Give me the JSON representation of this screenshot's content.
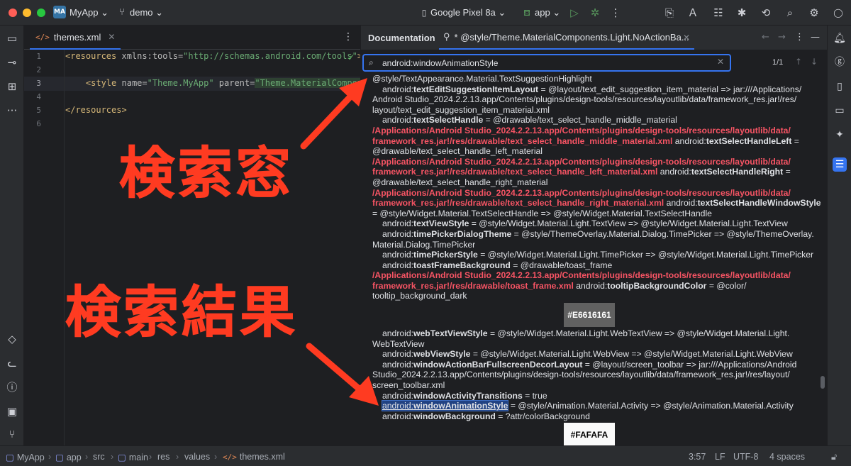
{
  "titlebar": {
    "project_badge": "MA",
    "project_name": "MyApp",
    "branch": "demo",
    "device": "Google Pixel 8a",
    "run_config": "app",
    "icons": [
      "folder-icon",
      "branch-icon",
      "device-icon",
      "android-icon",
      "run-icon",
      "debug-icon",
      "gradle-icon",
      "translate-icon",
      "layout-icon",
      "bug-icon",
      "sync-icon",
      "search-icon",
      "gear-icon"
    ]
  },
  "editor": {
    "tab_label": "themes.xml",
    "tab_icon": "</>",
    "line_numbers": [
      "1",
      "2",
      "3",
      "4",
      "5",
      "6"
    ],
    "lines": [
      {
        "tag_open": "<resources",
        "attr": " xmlns:tools=",
        "val": "\"http://schemas.android.com/tools\"",
        "tag_close": ">"
      },
      {
        "text": ""
      },
      {
        "indent": "    ",
        "tag_open": "<style",
        "attr1": " name=",
        "val1": "\"Theme.MyApp\"",
        "attr2": " parent=",
        "val2": "\"Theme.MaterialComponents"
      },
      {
        "text": ""
      },
      {
        "tag_open": "</resources>"
      },
      {
        "text": ""
      }
    ]
  },
  "documentation": {
    "panel_title": "Documentation",
    "tab_label": "* @style/Theme.MaterialComponents.Light.NoActionBa...",
    "search_value": "android:windowAnimationStyle",
    "match_count": "1/1",
    "lines": [
      {
        "t": "@style/TextAppearance.Material.TextSuggestionHighlight"
      },
      {
        "i": true,
        "p": "android:",
        "b": "textEditSuggestionItemLayout",
        "s": " = @layout/text_edit_suggestion_item_material => jar:///Applications/"
      },
      {
        "t": "Android Studio_2024.2.2.13.app/Contents/plugins/design-tools/resources/layoutlib/data/framework_res.jar!/res/"
      },
      {
        "t": "layout/text_edit_suggestion_item_material.xml"
      },
      {
        "i": true,
        "p": "android:",
        "b": "textSelectHandle",
        "s": " = @drawable/text_select_handle_middle_material"
      },
      {
        "r": "/Applications/Android Studio_2024.2.2.13.app/Contents/plugins/design-tools/resources/layoutlib/data/"
      },
      {
        "r": "framework_res.jar!/res/drawable/text_select_handle_middle_material.xml",
        "p": "     android:",
        "b": "textSelectHandleLeft",
        "s": " ="
      },
      {
        "t": "@drawable/text_select_handle_left_material"
      },
      {
        "r": "/Applications/Android Studio_2024.2.2.13.app/Contents/plugins/design-tools/resources/layoutlib/data/"
      },
      {
        "r": "framework_res.jar!/res/drawable/text_select_handle_left_material.xml",
        "p": "     android:",
        "b": "textSelectHandleRight",
        "s": " ="
      },
      {
        "t": "@drawable/text_select_handle_right_material"
      },
      {
        "r": "/Applications/Android Studio_2024.2.2.13.app/Contents/plugins/design-tools/resources/layoutlib/data/"
      },
      {
        "r": "framework_res.jar!/res/drawable/text_select_handle_right_material.xml",
        "p": "     android:",
        "b": "textSelectHandleWindowStyle",
        "s": ""
      },
      {
        "t": "= @style/Widget.Material.TextSelectHandle => @style/Widget.Material.TextSelectHandle"
      },
      {
        "i": true,
        "p": "android:",
        "b": "textViewStyle",
        "s": " = @style/Widget.Material.Light.TextView => @style/Widget.Material.Light.TextView"
      },
      {
        "i": true,
        "p": "android:",
        "b": "timePickerDialogTheme",
        "s": " = @style/ThemeOverlay.Material.Dialog.TimePicker => @style/ThemeOverlay."
      },
      {
        "t": "Material.Dialog.TimePicker"
      },
      {
        "i": true,
        "p": "android:",
        "b": "timePickerStyle",
        "s": " = @style/Widget.Material.Light.TimePicker => @style/Widget.Material.Light.TimePicker"
      },
      {
        "i": true,
        "p": "android:",
        "b": "toastFrameBackground",
        "s": " = @drawable/toast_frame"
      },
      {
        "r": "/Applications/Android Studio_2024.2.2.13.app/Contents/plugins/design-tools/resources/layoutlib/data/"
      },
      {
        "r": "framework_res.jar!/res/drawable/toast_frame.xml",
        "p": "     android:",
        "b": "tooltipBackgroundColor",
        "s": " = @color/"
      },
      {
        "t": "tooltip_background_dark"
      },
      {
        "swatch": "#E6616161",
        "dark": true
      },
      {
        "i": true,
        "p": "android:",
        "b": "webTextViewStyle",
        "s": " = @style/Widget.Material.Light.WebTextView => @style/Widget.Material.Light."
      },
      {
        "t": "WebTextView"
      },
      {
        "i": true,
        "p": "android:",
        "b": "webViewStyle",
        "s": " = @style/Widget.Material.Light.WebView => @style/Widget.Material.Light.WebView"
      },
      {
        "i": true,
        "p": "android:",
        "b": "windowActionBarFullscreenDecorLayout",
        "s": " = @layout/screen_toolbar => jar:///Applications/Android"
      },
      {
        "t": "Studio_2024.2.2.13.app/Contents/plugins/design-tools/resources/layoutlib/data/framework_res.jar!/res/layout/"
      },
      {
        "t": "screen_toolbar.xml"
      },
      {
        "i": true,
        "p": "android:",
        "b": "windowActivityTransitions",
        "s": " = true"
      },
      {
        "i": true,
        "hp": "android:",
        "hb": "windowAnimationStyle",
        "s": " = @style/Animation.Material.Activity => @style/Animation.Material.Activity"
      },
      {
        "i": true,
        "p": "android:",
        "b": "windowBackground",
        "s": " = ?attr/colorBackground"
      },
      {
        "swatch": "#FAFAFA",
        "dark": false
      }
    ]
  },
  "statusbar": {
    "breadcrumbs": [
      "MyApp",
      "app",
      "src",
      "main",
      "res",
      "values",
      "themes.xml"
    ],
    "position": "3:57",
    "line_sep": "LF",
    "encoding": "UTF-8",
    "indent": "4 spaces"
  },
  "annotations": {
    "search_window": "検索窓",
    "search_result": "検索結果",
    "color": "#ff3b21"
  }
}
